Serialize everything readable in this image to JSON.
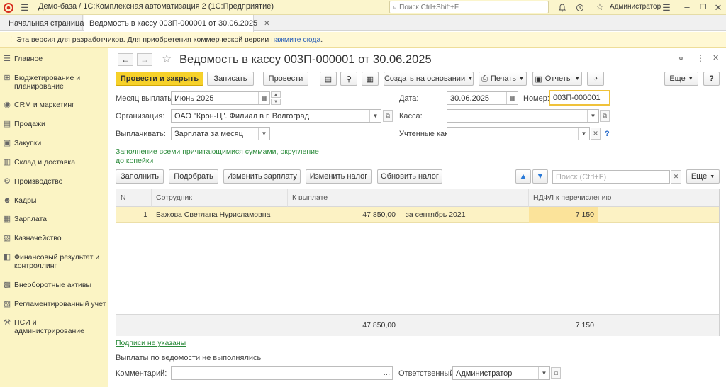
{
  "app": {
    "title": "Демо-база / 1С:Комплексная автоматизация 2  (1С:Предприятие)",
    "search_placeholder": "Поиск Ctrl+Shift+F",
    "user": "Администратор"
  },
  "tabs": {
    "home": "Начальная страница",
    "doc": "Ведомость в кассу 003П-000001 от 30.06.2025"
  },
  "banner": {
    "text": "Эта версия для разработчиков. Для приобретения коммерческой версии",
    "link": "нажмите сюда",
    "period": "."
  },
  "sidebar": {
    "items": [
      {
        "icon": "list-icon",
        "label": "Главное"
      },
      {
        "icon": "budget-icon",
        "label": "Бюджетирование и планирование"
      },
      {
        "icon": "crm-icon",
        "label": "CRM и маркетинг"
      },
      {
        "icon": "sales-icon",
        "label": "Продажи"
      },
      {
        "icon": "purchases-icon",
        "label": "Закупки"
      },
      {
        "icon": "warehouse-icon",
        "label": "Склад и доставка"
      },
      {
        "icon": "production-icon",
        "label": "Производство"
      },
      {
        "icon": "staff-icon",
        "label": "Кадры"
      },
      {
        "icon": "salary-icon",
        "label": "Зарплата"
      },
      {
        "icon": "treasury-icon",
        "label": "Казначейство"
      },
      {
        "icon": "finance-icon",
        "label": "Финансовый результат и контроллинг"
      },
      {
        "icon": "assets-icon",
        "label": "Внеоборотные активы"
      },
      {
        "icon": "regulated-icon",
        "label": "Регламентированный учет"
      },
      {
        "icon": "admin-icon",
        "label": "НСИ и администрирование"
      }
    ]
  },
  "form": {
    "title": "Ведомость в кассу 003П-000001 от 30.06.2025",
    "toolbar": {
      "post_close": "Провести и закрыть",
      "save": "Записать",
      "post": "Провести",
      "create_based": "Создать на основании",
      "print": "Печать",
      "reports": "Отчеты",
      "more": "Еще",
      "help": "?"
    },
    "fields": {
      "month_label": "Месяц выплаты:",
      "month_value": "Июнь 2025",
      "date_label": "Дата:",
      "date_value": "30.06.2025",
      "number_label": "Номер:",
      "number_value": "003П-000001",
      "org_label": "Организация:",
      "org_value": "ОАО \"Крон-Ц\". Филиал в г. Волгоград",
      "cash_label": "Касса:",
      "cash_value": "",
      "pay_label": "Выплачивать:",
      "pay_value": "Зарплата за месяц",
      "counted_label": "Учтенные как:",
      "counted_value": "",
      "fill_link": "Заполнение всеми причитающимися суммами, округление до копейки"
    },
    "table_toolbar": {
      "fill": "Заполнить",
      "pick": "Подобрать",
      "change_salary": "Изменить зарплату",
      "change_tax": "Изменить налог",
      "update_tax": "Обновить налог",
      "search_placeholder": "Поиск (Ctrl+F)",
      "more": "Еще"
    },
    "table": {
      "columns": [
        "N",
        "Сотрудник",
        "К выплате",
        "НДФЛ к перечислению"
      ],
      "rows": [
        {
          "n": "1",
          "employee": "Бажова Светлана Нурисламовна",
          "amount": "47 850,00",
          "period": "за сентябрь 2021",
          "tax": "7 150"
        }
      ],
      "totals": {
        "amount": "47 850,00",
        "tax": "7 150"
      }
    },
    "footer": {
      "signatures_link": "Подписи не указаны",
      "status": "Выплаты по ведомости не выполнялись",
      "comment_label": "Комментарий:",
      "comment_value": "",
      "responsible_label": "Ответственный:",
      "responsible_value": "Администратор"
    }
  }
}
